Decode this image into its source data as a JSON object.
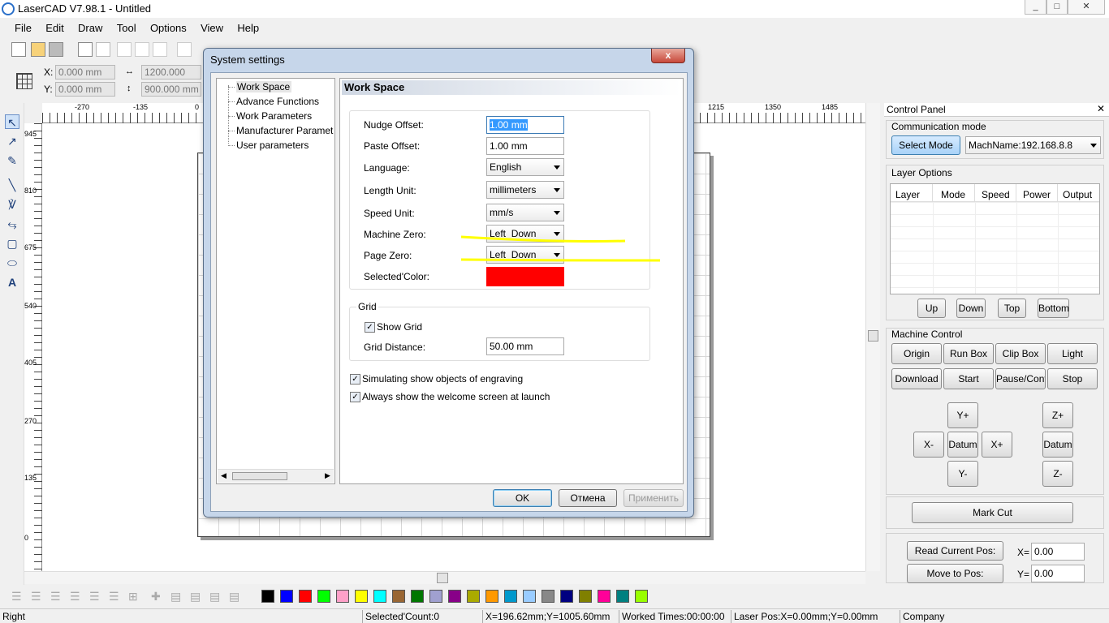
{
  "window": {
    "title": "LaserCAD V7.98.1 - Untitled"
  },
  "menu": [
    "File",
    "Edit",
    "Draw",
    "Tool",
    "Options",
    "View",
    "Help"
  ],
  "toolbar2": {
    "x_label": "X:",
    "y_label": "Y:",
    "x_value": "0.000 mm",
    "y_value": "0.000 mm",
    "w_value": "1200.000 mm",
    "h_value": "900.000 mm"
  },
  "ruler": {
    "h_ticks": [
      "-270",
      "-135",
      "0",
      "1215",
      "1350",
      "1485"
    ],
    "v_ticks": [
      "945",
      "810",
      "675",
      "540",
      "405",
      "270",
      "135",
      "0"
    ]
  },
  "dialog": {
    "title": "System settings",
    "close": "x",
    "tree": [
      "Work Space",
      "Advance Functions",
      "Work Parameters",
      "Manufacturer Paramet",
      "User parameters"
    ],
    "panel_title": "Work Space",
    "fields": {
      "nudge_label": "Nudge Offset:",
      "nudge_value": "1.00 mm",
      "paste_label": "Paste Offset:",
      "paste_value": "1.00 mm",
      "language_label": "Language:",
      "language_value": "English",
      "length_label": "Length Unit:",
      "length_value": "millimeters",
      "speed_label": "Speed Unit:",
      "speed_value": "mm/s",
      "machine_zero_label": "Machine Zero:",
      "machine_zero_value": "Left_Down",
      "page_zero_label": "Page Zero:",
      "page_zero_value": "Left_Down",
      "selected_color_label": "Selected'Color:",
      "selected_color": "#ff0000"
    },
    "grid": {
      "title": "Grid",
      "show_grid_label": "Show Grid",
      "show_grid": true,
      "distance_label": "Grid Distance:",
      "distance_value": "50.00 mm"
    },
    "options": [
      {
        "label": "Simulating show objects of engraving",
        "checked": true
      },
      {
        "label": "Always show the welcome screen at launch",
        "checked": true
      }
    ],
    "buttons": {
      "ok": "OK",
      "cancel": "Отмена",
      "apply": "Применить"
    }
  },
  "control_panel": {
    "title": "Control Panel",
    "comm_title": "Communication mode",
    "select_mode": "Select Mode",
    "machine": "MachName:192.168.8.8",
    "layer_title": "Layer Options",
    "layer_columns": [
      "Layer",
      "Mode",
      "Speed",
      "Power",
      "Output"
    ],
    "layer_buttons": [
      "Up",
      "Down",
      "Top",
      "Bottom"
    ],
    "machine_title": "Machine Control",
    "machine_buttons_row1": [
      "Origin",
      "Run Box",
      "Clip Box",
      "Light"
    ],
    "machine_buttons_row2": [
      "Download",
      "Start",
      "Pause/Continue",
      "Stop"
    ],
    "jog": {
      "yplus": "Y+",
      "xminus": "X-",
      "datum": "Datum",
      "xplus": "X+",
      "yminus": "Y-",
      "zplus": "Z+",
      "zdatum": "Datum",
      "zminus": "Z-"
    },
    "mark_cut": "Mark Cut",
    "read_pos": "Read Current Pos:",
    "move_pos": "Move to Pos:",
    "x_label": "X=",
    "x_value": "0.00",
    "y_label": "Y=",
    "y_value": "0.00"
  },
  "palette": [
    "#000000",
    "#0000ff",
    "#ff0000",
    "#00ff00",
    "#ffa0c8",
    "#ffff00",
    "#00ffff",
    "#996633",
    "#007700",
    "#a0a0d0",
    "#880088",
    "#aaaa00",
    "#ff9900",
    "#0099cc",
    "#99ccff",
    "#888888",
    "#000080",
    "#808000",
    "#ff0099",
    "#008080",
    "#99ff00"
  ],
  "status": {
    "left": "Right",
    "selected": "Selected'Count:0",
    "coords": "X=196.62mm;Y=1005.60mm",
    "worked": "Worked Times:00:00:00",
    "laser": "Laser Pos:X=0.00mm;Y=0.00mm",
    "company": "Company"
  },
  "highlight_color": "#ffff00"
}
